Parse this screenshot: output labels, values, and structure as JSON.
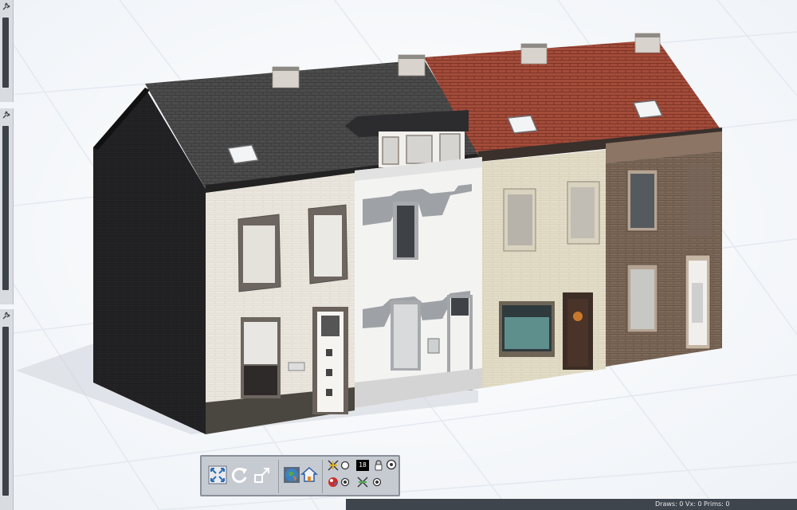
{
  "viewport": {
    "object": "terraced-houses-model"
  },
  "toolbar": {
    "frame_counter": "18"
  },
  "statusbar": {
    "stats": "Draws: 0 Vx: 0 Prims: 0"
  },
  "colors": {
    "ground": "#ffffff",
    "grid_lines": "#e3e8ef",
    "toolbar_bg": "#c6cbd2",
    "statusbar_bg": "#3f454d",
    "side_panel_bg": "#d8dce1",
    "roof_dark": "#505050",
    "roof_red": "#a24b3a",
    "wall_black": "#1d1d1f"
  },
  "icons": [
    "pin-icon",
    "expand-view-icon",
    "rotate-icon",
    "resize-icon",
    "globe-texture-icon",
    "home-icon",
    "grid-toggle-icon",
    "lock-icon",
    "radio-icon",
    "color-palette-icon",
    "snap-icon",
    "target-icon"
  ]
}
